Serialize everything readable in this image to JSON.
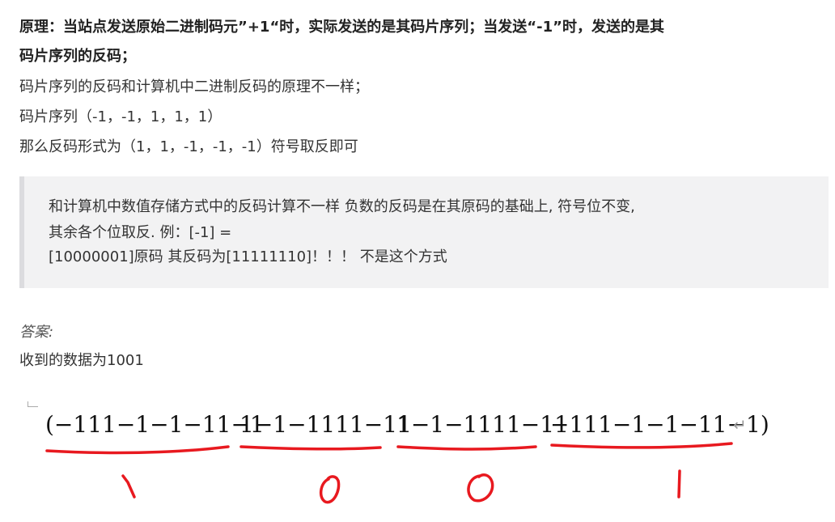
{
  "document": {
    "line1_prefix": "原理：当站点发送原始二进制码元”",
    "line1_plus": "+1",
    "line1_mid": "“时，实际发送的是其码片序列；当发送",
    "line1_minus": "“-1”",
    "line1_suffix": "时，发送的是其",
    "line2": "码片序列的反码；",
    "line3": "码片序列的反码和计算机中二进制反码的原理不一样；",
    "line4": "码片序列（-1，-1，1，1，1）",
    "line5": "那么反码形式为（1，1，-1，-1，-1）符号取反即可"
  },
  "quote": {
    "line1": "和计算机中数值存储方式中的反码计算不一样 负数的反码是在其原码的基础上, 符号位不变,",
    "line2": "其余各个位取反. 例：[-1] =",
    "line3": "[10000001]原码 其反码为[11111110]！！！ 不是这个方式"
  },
  "answer": {
    "label": "答案:",
    "result": "收到的数据为1001"
  },
  "equation": {
    "groups": [
      "(−111−1−1−11−1",
      "1−1−1111−11",
      "1−1−1111−11",
      "−111−1−1−11−1)"
    ],
    "return_mark": "↵"
  },
  "handwriting": {
    "digits": [
      "1",
      "0",
      "0",
      "1"
    ],
    "ink_color": "#e8191f"
  }
}
